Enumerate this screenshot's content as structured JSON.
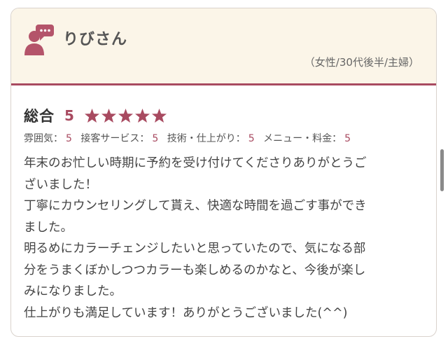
{
  "reviewer": {
    "name": "りびさん",
    "meta": "（女性/30代後半/主婦）"
  },
  "rating": {
    "label": "総合",
    "score": "5",
    "stars": 5,
    "star_color": "#a84a60",
    "sub_ratings": [
      {
        "label": "雰囲気：",
        "value": "5"
      },
      {
        "label": "接客サービス：",
        "value": "5"
      },
      {
        "label": "技術・仕上がり：",
        "value": "5"
      },
      {
        "label": "メニュー・料金：",
        "value": "5"
      }
    ]
  },
  "review": {
    "lines": [
      "年末のお忙しい時期に予約を受け付けてくださりありがとうご",
      "ざいました！",
      "丁寧にカウンセリングして貰え、快適な時間を過ごす事ができ",
      "ました。",
      "明るめにカラーチェンジしたいと思っていたので、気になる部",
      "分をうまくぼかしつつカラーも楽しめるのかなと、今後が楽し",
      "みになりました。",
      "仕上がりも満足しています！ありがとうございました(^^)"
    ]
  },
  "colors": {
    "accent": "#a84a60",
    "header_bg": "#fbf5e8"
  }
}
